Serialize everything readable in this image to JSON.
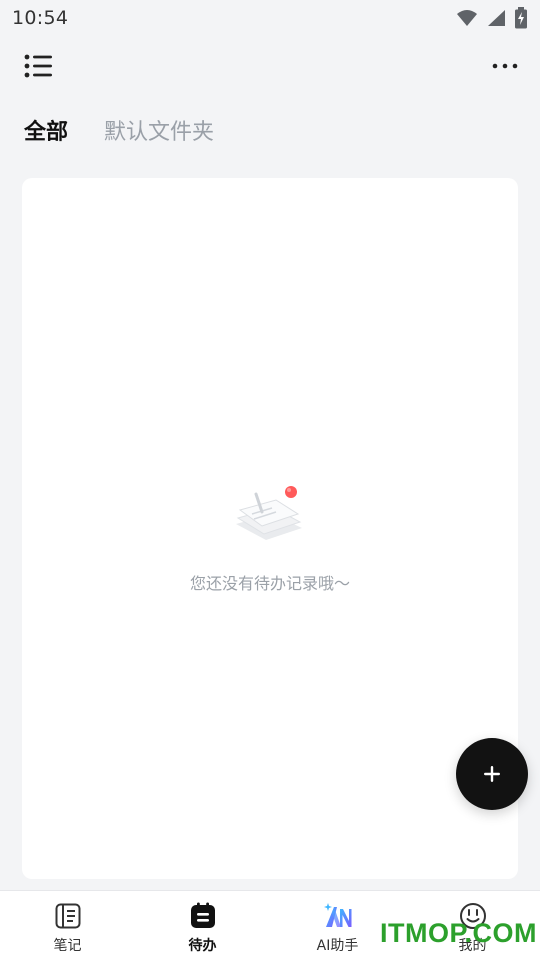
{
  "status_bar": {
    "time": "10:54",
    "icons": [
      "wifi-icon",
      "signal-icon",
      "battery-charging-icon"
    ]
  },
  "top_bar": {
    "menu_icon": "list-menu-icon",
    "more_icon": "more-horizontal-icon"
  },
  "tabs": [
    {
      "label": "全部",
      "active": true
    },
    {
      "label": "默认文件夹",
      "active": false
    }
  ],
  "empty_state": {
    "illustration": "empty-notes-illustration",
    "message": "您还没有待办记录哦～"
  },
  "fab": {
    "icon": "plus-icon"
  },
  "bottom_nav": {
    "items": [
      {
        "label": "笔记",
        "icon": "notebook-icon",
        "active": false
      },
      {
        "label": "待办",
        "icon": "todo-icon",
        "active": true
      },
      {
        "label": "AI助手",
        "icon": "ai-assistant-icon",
        "active": false
      },
      {
        "label": "我的",
        "icon": "profile-smile-icon",
        "active": false
      }
    ]
  },
  "watermark": "ITMOP.COM",
  "colors": {
    "background": "#f3f4f6",
    "card": "#ffffff",
    "fab": "#121212",
    "inactive_tab": "#9aa0a8",
    "ai_gradient_start": "#3fb6ff",
    "ai_gradient_end": "#7a5cff",
    "illustration_dot": "#ff5a5a",
    "watermark": "#2ca02c"
  }
}
